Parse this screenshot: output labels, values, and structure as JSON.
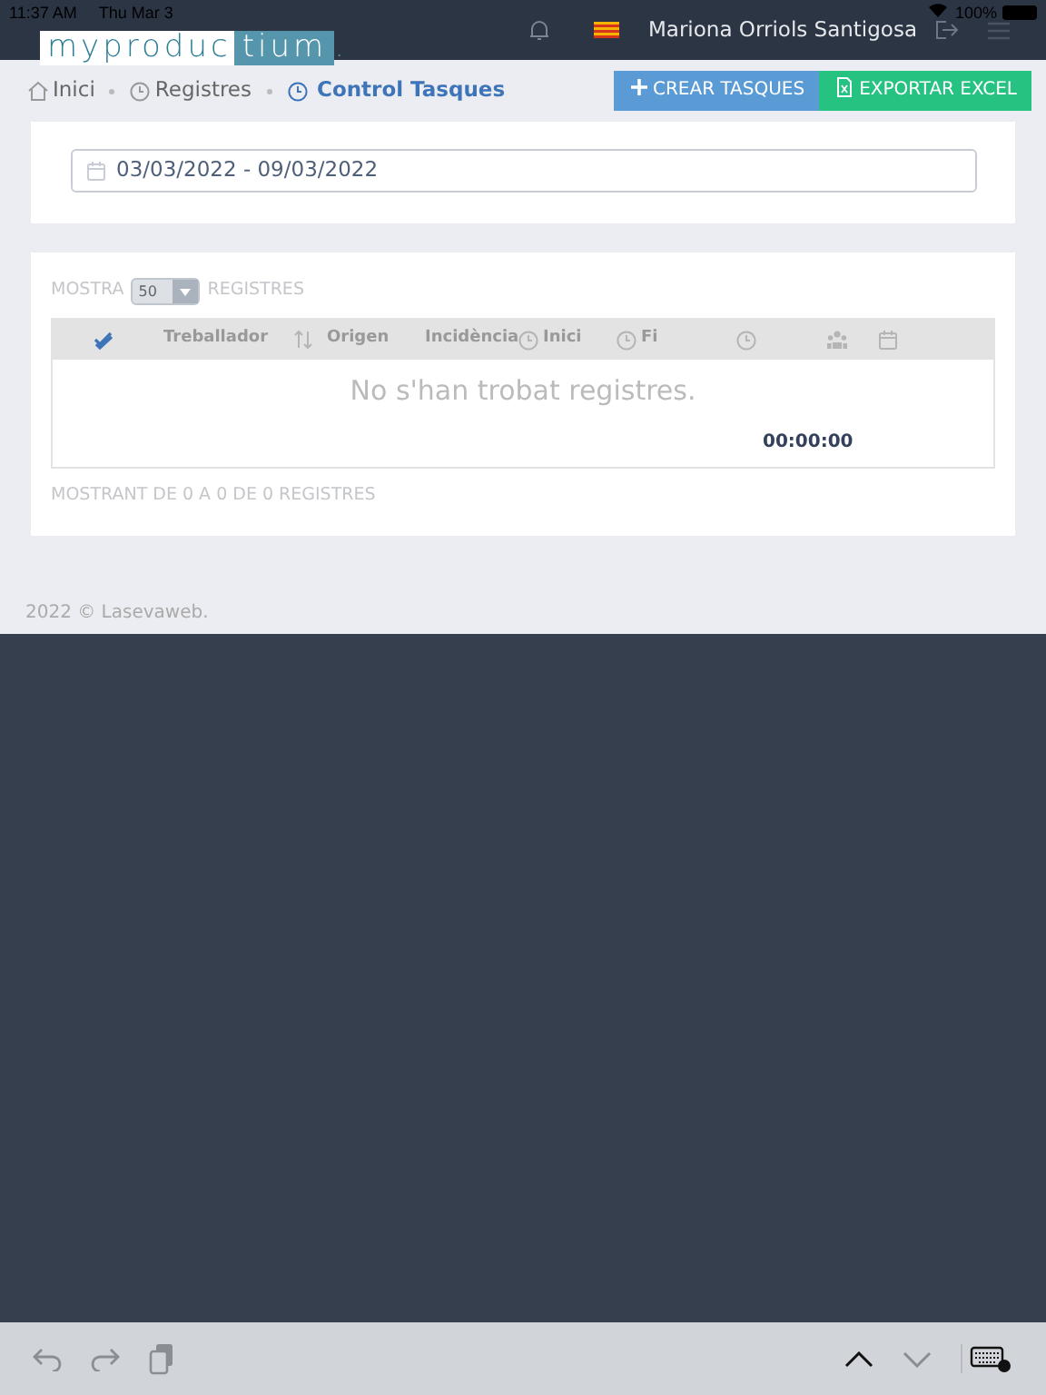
{
  "status_bar": {
    "time": "11:37 AM",
    "date": "Thu Mar 3",
    "battery": "100%"
  },
  "navbar": {
    "logo": {
      "part_1": "myproduc",
      "part_2": "tium",
      "dot": "."
    },
    "user": "Mariona Orriols Santigosa"
  },
  "breadcrumb": [
    {
      "label": "Inici",
      "selected": false
    },
    {
      "label": "Registres",
      "selected": false
    },
    {
      "label": "Control Tasques",
      "selected": true
    }
  ],
  "buttons": [
    {
      "label": "CREAR TASQUES",
      "kind": "create"
    },
    {
      "label": "EXPORTAR EXCEL",
      "kind": "export"
    }
  ],
  "date_range": {
    "value": "03/03/2022 - 09/03/2022"
  },
  "table": {
    "length_before": "MOSTRA",
    "page_size": "50",
    "length_after": "REGISTRES",
    "columns": [
      {
        "kind": "check"
      },
      {
        "kind": "text",
        "label": "Treballador"
      },
      {
        "kind": "sort"
      },
      {
        "kind": "text",
        "label": "Origen"
      },
      {
        "kind": "text",
        "label": "Incidència"
      },
      {
        "kind": "timed",
        "label": "Inici"
      },
      {
        "kind": "timed",
        "label": "Fi"
      },
      {
        "kind": "duration"
      },
      {
        "kind": "group"
      },
      {
        "kind": "calendar"
      }
    ],
    "empty_message": "No s'han trobat registres.",
    "total": "00:00:00",
    "info": "MOSTRANT DE 0 A 0 DE 0 REGISTRES"
  },
  "footer": "2022 © Lasevaweb."
}
